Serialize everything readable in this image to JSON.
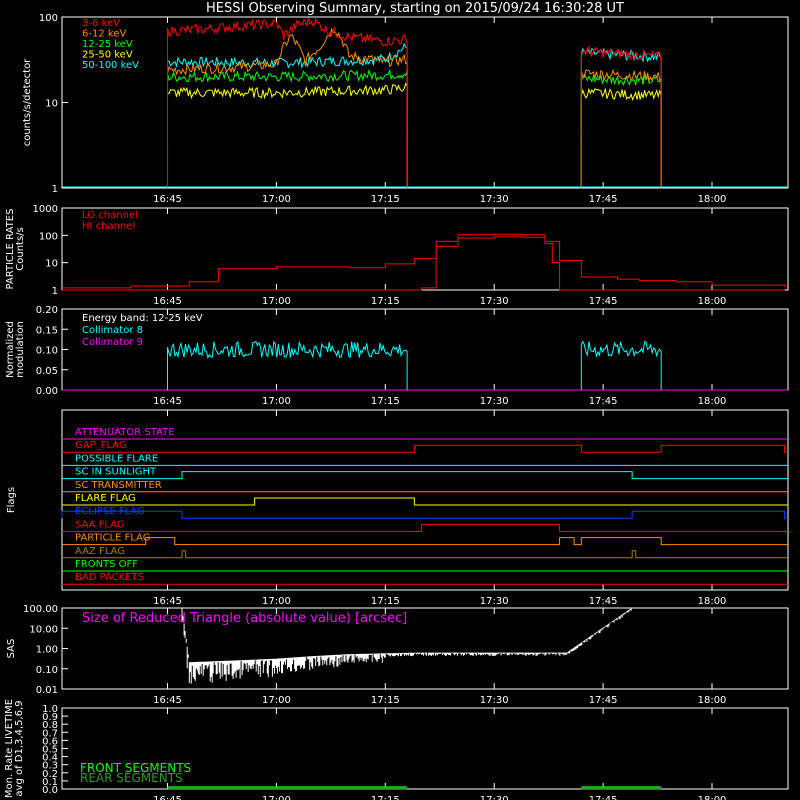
{
  "title": "HESSI Observing Summary, starting on 2015/09/24 16:30:28 UT",
  "time_ticks": [
    "16:45",
    "17:00",
    "17:15",
    "17:30",
    "17:45",
    "18:00"
  ],
  "colors": {
    "red": "#ff0000",
    "orange": "#ff8c00",
    "yellow": "#ffff00",
    "green": "#00ff00",
    "cyan": "#00ffff",
    "magenta": "#ff00ff",
    "blue": "#0040ff",
    "olive": "#a08000",
    "white": "#ffffff"
  },
  "chart_data": [
    {
      "type": "line",
      "ylabel": "counts/s/detector",
      "yscale": "log",
      "ylim": [
        1,
        100
      ],
      "ytick_labels": [
        "1",
        "10",
        "100"
      ],
      "legend": [
        "3-6 keV",
        "6-12 keV",
        "12-25 keV",
        "25-50 keV",
        "50-100 keV"
      ],
      "series": [
        {
          "name": "3-6 keV",
          "color": "red",
          "segments": [
            {
              "x": [
                "16:45",
                "16:50",
                "16:55",
                "17:00",
                "17:01",
                "17:03",
                "17:05",
                "17:07",
                "17:10",
                "17:15",
                "17:18"
              ],
              "y": [
                68,
                72,
                78,
                84,
                60,
                82,
                90,
                70,
                58,
                52,
                55
              ]
            },
            {
              "x": [
                "17:42",
                "17:45",
                "17:50",
                "17:53"
              ],
              "y": [
                40,
                38,
                36,
                34
              ]
            }
          ]
        },
        {
          "name": "6-12 keV",
          "color": "orange",
          "segments": [
            {
              "x": [
                "16:45",
                "16:55",
                "17:00",
                "17:02",
                "17:04",
                "17:06",
                "17:08",
                "17:10",
                "17:15",
                "17:18"
              ],
              "y": [
                24,
                26,
                28,
                60,
                30,
                45,
                75,
                35,
                30,
                32
              ]
            },
            {
              "x": [
                "17:42",
                "17:53"
              ],
              "y": [
                22,
                20
              ]
            }
          ]
        },
        {
          "name": "12-25 keV",
          "color": "green",
          "segments": [
            {
              "x": [
                "16:45",
                "17:00",
                "17:15",
                "17:18"
              ],
              "y": [
                20,
                20,
                21,
                22
              ]
            },
            {
              "x": [
                "17:42",
                "17:53"
              ],
              "y": [
                19,
                18
              ]
            }
          ]
        },
        {
          "name": "25-50 keV",
          "color": "yellow",
          "segments": [
            {
              "x": [
                "16:45",
                "17:00",
                "17:15",
                "17:18"
              ],
              "y": [
                13,
                13,
                14,
                15
              ]
            },
            {
              "x": [
                "17:42",
                "17:53"
              ],
              "y": [
                13,
                12
              ]
            }
          ]
        },
        {
          "name": "50-100 keV",
          "color": "cyan",
          "segments": [
            {
              "x": [
                "16:45",
                "17:00",
                "17:15",
                "17:18"
              ],
              "y": [
                30,
                29,
                32,
                45
              ]
            },
            {
              "x": [
                "17:42",
                "17:53"
              ],
              "y": [
                38,
                34
              ]
            }
          ]
        }
      ]
    },
    {
      "type": "line",
      "ylabel": "PARTICLE RATES Counts/s",
      "yscale": "log",
      "ylim": [
        1,
        1000
      ],
      "ytick_labels": [
        "1",
        "10",
        "100",
        "1000"
      ],
      "legend": [
        "LO channel",
        "HI channel"
      ],
      "series": [
        {
          "name": "LO channel",
          "color": "red",
          "x": [
            "16:30:28",
            "16:40",
            "16:48",
            "16:52",
            "17:00",
            "17:10",
            "17:15",
            "17:19",
            "17:22",
            "17:25",
            "17:30",
            "17:34",
            "17:37",
            "17:39",
            "17:42",
            "17:47",
            "17:50",
            "17:55",
            "18:00",
            "18:10"
          ],
          "y": [
            1.2,
            1.4,
            2,
            6,
            7,
            6.5,
            9,
            14,
            60,
            105,
            110,
            105,
            60,
            12,
            3,
            2.5,
            2.2,
            2,
            1.5,
            1.3
          ]
        },
        {
          "name": "HI channel",
          "color": "red",
          "x": [
            "16:30:28",
            "17:19",
            "17:20",
            "17:22",
            "17:25",
            "17:30",
            "17:34",
            "17:37",
            "17:38",
            "17:39",
            "18:10"
          ],
          "y": [
            1,
            1,
            1.2,
            40,
            80,
            88,
            85,
            50,
            10,
            1,
            1
          ]
        }
      ]
    },
    {
      "type": "line",
      "ylabel": "Normalized modulation",
      "ylim": [
        0.0,
        0.2
      ],
      "ytick_labels": [
        "0.00",
        "0.05",
        "0.10",
        "0.15",
        "0.20"
      ],
      "legend": [
        "Energy band: 12-25 keV",
        "Collimator 8",
        "Collimator 9"
      ],
      "series": [
        {
          "name": "Collimator 8",
          "color": "cyan",
          "segments": [
            {
              "x": [
                "16:45",
                "17:18"
              ],
              "y": [
                0.1,
                0.1
              ]
            },
            {
              "x": [
                "17:42",
                "17:53"
              ],
              "y": [
                0.1,
                0.1
              ]
            }
          ]
        },
        {
          "name": "Collimator 9",
          "color": "magenta",
          "segments": [
            {
              "x": [
                "16:30:28",
                "18:10"
              ],
              "y": [
                0,
                0
              ]
            }
          ]
        }
      ]
    },
    {
      "type": "line",
      "ylabel": "Flags",
      "flags": [
        {
          "name": "ATTENUATOR STATE",
          "color": "magenta",
          "on": []
        },
        {
          "name": "GAP_FLAG",
          "color": "red",
          "on": [
            [
              "17:19",
              "17:42"
            ],
            [
              "17:53",
              "18:10"
            ]
          ]
        },
        {
          "name": "POSSIBLE FLARE",
          "color": "cyan",
          "on": []
        },
        {
          "name": "SC IN SUNLIGHT",
          "color": "cyan",
          "on": [
            [
              "16:47",
              "17:49"
            ]
          ]
        },
        {
          "name": "SC TRANSMITTER",
          "color": "orange",
          "on": []
        },
        {
          "name": "FLARE FLAG",
          "color": "yellow",
          "on": [
            [
              "16:57",
              "17:19"
            ]
          ]
        },
        {
          "name": "ECLIPSE FLAG",
          "color": "blue",
          "on": [
            [
              "16:30:28",
              "16:47"
            ],
            [
              "17:49",
              "18:10"
            ]
          ]
        },
        {
          "name": "SAA FLAG",
          "color": "red",
          "on": [
            [
              "17:20",
              "17:39"
            ]
          ]
        },
        {
          "name": "PARTICLE FLAG",
          "color": "orange",
          "on": [
            [
              "16:42",
              "16:46"
            ],
            [
              "17:39",
              "17:41"
            ],
            [
              "17:42",
              "17:53"
            ]
          ]
        },
        {
          "name": "AAZ FLAG",
          "color": "olive",
          "on": [
            [
              "16:47",
              "16:47:30"
            ],
            [
              "17:49",
              "17:49:30"
            ]
          ]
        },
        {
          "name": "FRONTS OFF",
          "color": "green",
          "on": []
        },
        {
          "name": "BAD PACKETS",
          "color": "red",
          "on": []
        }
      ]
    },
    {
      "type": "line",
      "ylabel": "SAS",
      "yscale": "log",
      "ylim": [
        0.01,
        100
      ],
      "ytick_labels": [
        "0.01",
        "0.10",
        "1.00",
        "10.00",
        "100.00"
      ],
      "legend": [
        "Size of Reduced Triangle (absolute value) [arcsec]"
      ],
      "series": [
        {
          "name": "Size of Reduced Triangle (absolute value) [arcsec]",
          "color": "white",
          "x": [
            "16:47",
            "16:48",
            "16:55",
            "17:00",
            "17:05",
            "17:10",
            "17:15",
            "17:20",
            "17:30",
            "17:40",
            "17:49"
          ],
          "y": [
            100,
            0.2,
            0.25,
            0.3,
            0.4,
            0.5,
            0.55,
            0.6,
            0.6,
            0.6,
            100
          ]
        }
      ]
    },
    {
      "type": "line",
      "ylabel": "Mon. Rate LIVETIME avg of D1,3,4,5,6,9",
      "ylim": [
        0.0,
        1.0
      ],
      "ytick_labels": [
        "0.0",
        "0.1",
        "0.2",
        "0.3",
        "0.4",
        "0.5",
        "0.6",
        "0.7",
        "0.8",
        "0.9",
        "1.0"
      ],
      "legend": [
        "FRONT SEGMENTS",
        "REAR SEGMENTS"
      ],
      "series": [
        {
          "name": "FRONT SEGMENTS",
          "color": "green",
          "segments": [
            {
              "x": [
                "16:45",
                "17:18"
              ],
              "y": [
                0.02,
                0.02
              ]
            },
            {
              "x": [
                "17:42",
                "17:53"
              ],
              "y": [
                0.02,
                0.02
              ]
            }
          ]
        },
        {
          "name": "REAR SEGMENTS",
          "color": "green",
          "segments": [
            {
              "x": [
                "16:45",
                "17:18"
              ],
              "y": [
                0.01,
                0.01
              ]
            },
            {
              "x": [
                "17:42",
                "17:53"
              ],
              "y": [
                0.01,
                0.01
              ]
            }
          ]
        }
      ]
    }
  ]
}
